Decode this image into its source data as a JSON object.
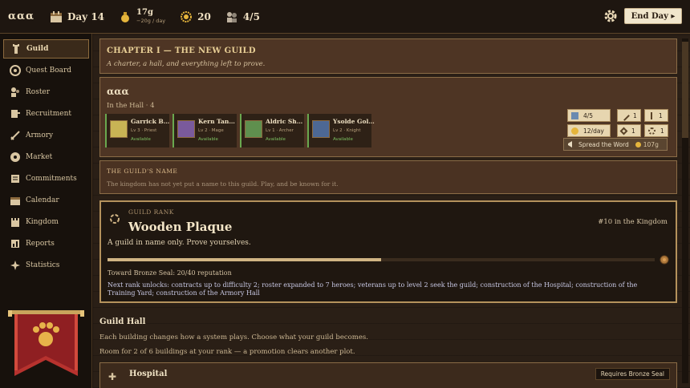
{
  "topbar": {
    "guild_name": "ααα",
    "day": "Day 14",
    "gold": "17g",
    "gold_rate": "−20g / day",
    "reputation": "20",
    "heroes": "4/5",
    "end_day": "End Day ▸"
  },
  "sidebar": {
    "items": [
      {
        "label": "Guild",
        "icon": "tower-icon"
      },
      {
        "label": "Quest Board",
        "icon": "board-icon"
      },
      {
        "label": "Roster",
        "icon": "roster-icon"
      },
      {
        "label": "Recruitment",
        "icon": "recruit-icon"
      },
      {
        "label": "Armory",
        "icon": "sword-icon"
      },
      {
        "label": "Market",
        "icon": "market-icon"
      },
      {
        "label": "Commitments",
        "icon": "commitments-icon"
      },
      {
        "label": "Calendar",
        "icon": "calendar-icon"
      },
      {
        "label": "Kingdom",
        "icon": "castle-icon"
      },
      {
        "label": "Reports",
        "icon": "reports-icon"
      },
      {
        "label": "Statistics",
        "icon": "sparkle-icon"
      }
    ]
  },
  "chapter": {
    "title": "CHAPTER I — THE NEW GUILD",
    "subtitle": "A charter, a hall, and everything left to prove."
  },
  "guild": {
    "name": "ααα",
    "in_hall": "In the Hall · 4",
    "heroes": [
      {
        "name": "Garrick B…",
        "level": "Lv 3 · Priest",
        "status": "Available",
        "color": "#c9b455"
      },
      {
        "name": "Kern Tan…",
        "level": "Lv 2 · Mage",
        "status": "Available",
        "color": "#7a5a9c"
      },
      {
        "name": "Aldric Sh…",
        "level": "Lv 1 · Archer",
        "status": "Available",
        "color": "#5f8f4e"
      },
      {
        "name": "Ysolde Gol…",
        "level": "Lv 2 · Knight",
        "status": "Available",
        "color": "#4d6894"
      }
    ],
    "chips": {
      "heroes": "4/5",
      "rate": "12/day",
      "melee": "1",
      "ranged": "1",
      "magic": "1",
      "holy": "1"
    },
    "spread": {
      "label": "Spread the Word",
      "cost": "107g"
    }
  },
  "guild_name_panel": {
    "title": "THE GUILD'S NAME",
    "text": "The kingdom has not yet put a name to this guild. Play, and be known for it."
  },
  "rank": {
    "label": "GUILD RANK",
    "name": "Wooden Plaque",
    "position": "#10 in the Kingdom",
    "description": "A guild in name only. Prove yourselves.",
    "progress": 0.5,
    "toward": "Toward Bronze Seal: 20/40 reputation",
    "unlocks": "Next rank unlocks: contracts up to difficulty 2; roster expanded to 7 heroes; veterans up to level 2 seek the guild; construction of the Hospital; construction of the Training Yard; construction of the Armory Hall"
  },
  "hall": {
    "title": "Guild Hall",
    "subtitle1": "Each building changes how a system plays. Choose what your guild becomes.",
    "subtitle2": "Room for 2 of 6 buildings at your rank — a promotion clears another plot."
  },
  "hospital": {
    "name": "Hospital",
    "requirement": "Requires Bronze Seal"
  }
}
